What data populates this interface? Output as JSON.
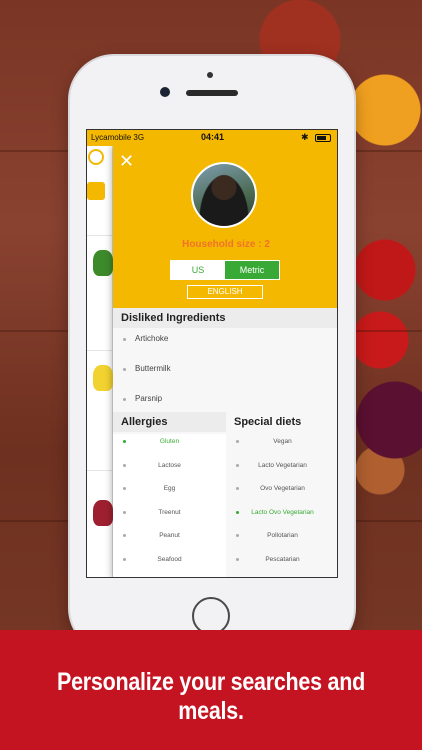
{
  "caption": "Personalize your searches and meals.",
  "status_bar": {
    "carrier": "Lycamobile  3G",
    "time": "04:41",
    "bluetooth": "✱"
  },
  "panel": {
    "close_icon": "✕",
    "household": "Household size : 2",
    "units": {
      "us": "US",
      "metric": "Metric",
      "selected": "Metric"
    },
    "language": "ENGLISH"
  },
  "disliked": {
    "title": "Disliked Ingredients",
    "items": [
      "Artichoke",
      "Buttermilk",
      "Parsnip"
    ]
  },
  "allergies": {
    "title": "Allergies",
    "items": [
      "Gluten",
      "Lactose",
      "Egg",
      "Treenut",
      "Peanut",
      "Seafood"
    ],
    "selected": "Gluten"
  },
  "diets": {
    "title": "Special diets",
    "items": [
      "Vegan",
      "Lacto Vegetarian",
      "Ovo Vegetarian",
      "Lacto Ovo Vegetarian",
      "Pollotarian",
      "Pescatarian"
    ],
    "selected": "Lacto Ovo Vegetarian"
  },
  "colors": {
    "accent": "#f5b800",
    "green": "#39a935",
    "household": "#f07428",
    "band": "#c41422"
  }
}
